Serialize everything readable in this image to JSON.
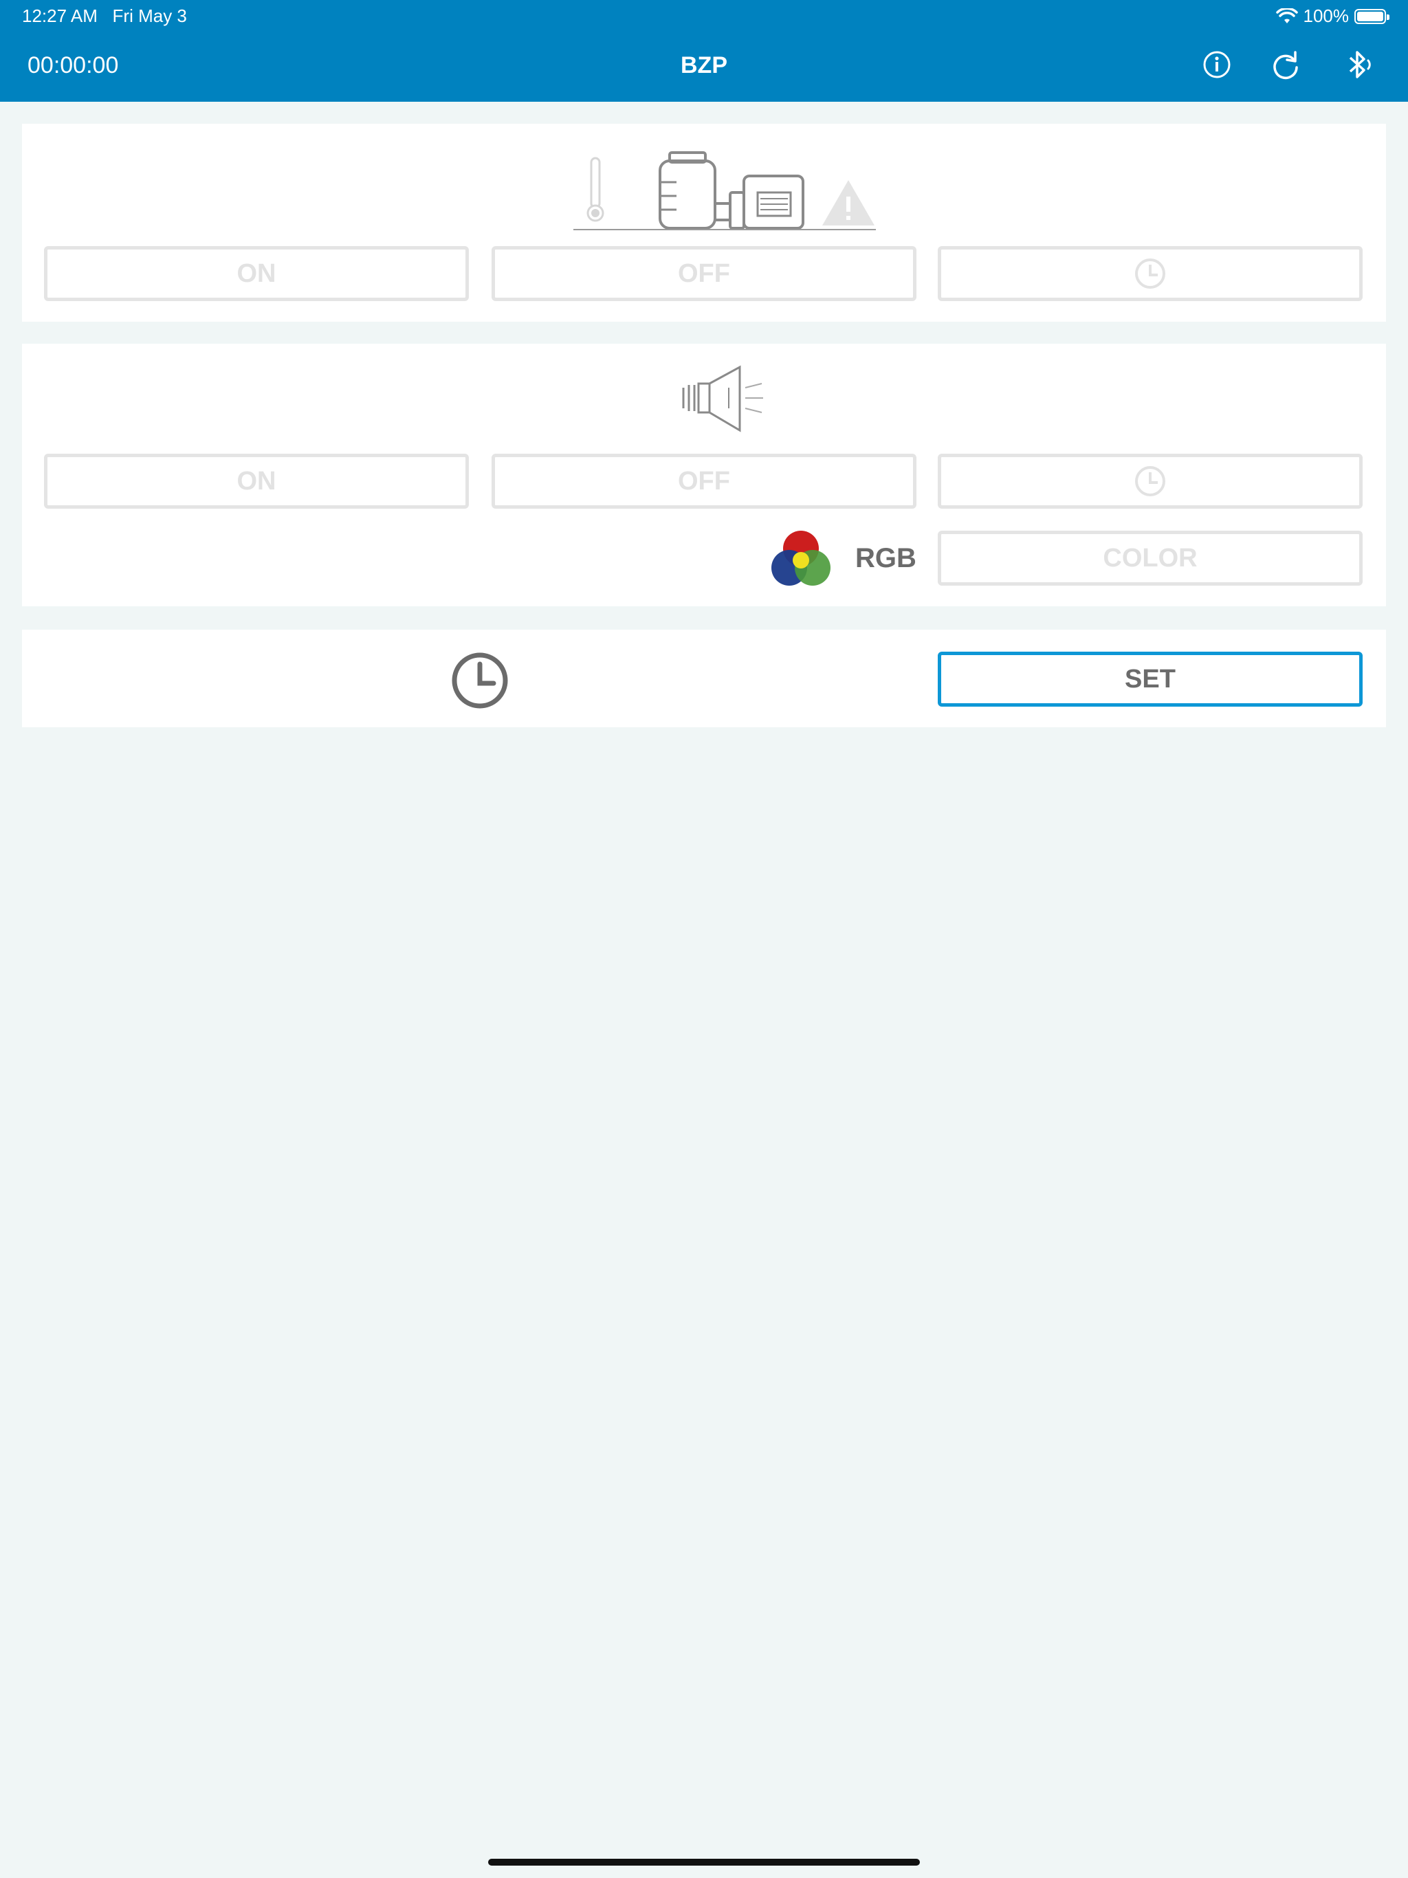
{
  "status_bar": {
    "time": "12:27 AM",
    "date": "Fri May 3",
    "battery": "100%",
    "battery_level": 1.0
  },
  "header": {
    "timer": "00:00:00",
    "title": "BZP"
  },
  "colors": {
    "header_bg": "#0082bf",
    "active_border": "#0d97d6",
    "disabled_text": "#e2e2e2",
    "panel_bg": "#ffffff",
    "page_bg": "#f0f6f6"
  },
  "pump_panel": {
    "icons": [
      "thermometer-icon",
      "pump-icon",
      "warning-icon"
    ],
    "on_label": "ON",
    "off_label": "OFF",
    "timer_icon": "clock-icon"
  },
  "horn_panel": {
    "icon": "speaker-icon",
    "on_label": "ON",
    "off_label": "OFF",
    "timer_icon": "clock-icon",
    "rgb_label": "RGB",
    "color_label": "COLOR"
  },
  "time_panel": {
    "icon": "clock-icon",
    "set_label": "SET"
  }
}
